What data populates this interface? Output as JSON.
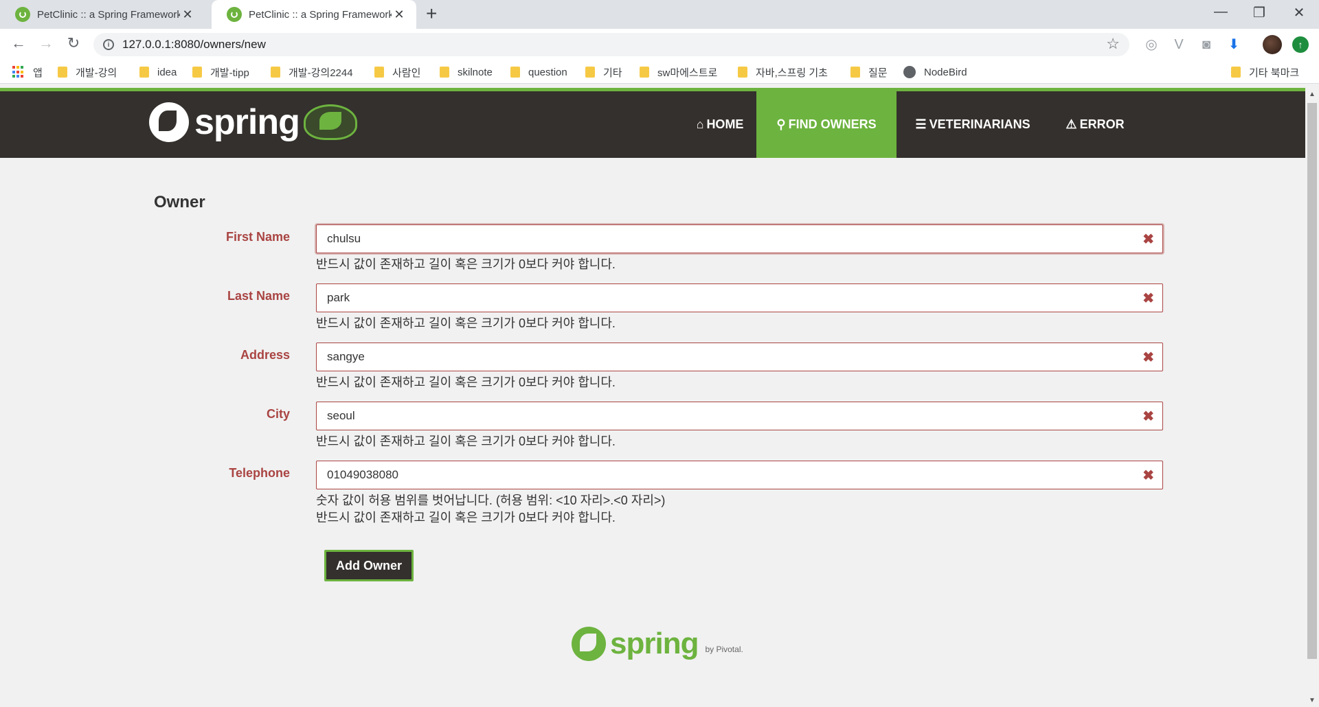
{
  "browser": {
    "tabs": [
      {
        "title": "PetClinic :: a Spring Framework"
      },
      {
        "title": "PetClinic :: a Spring Framework"
      }
    ],
    "new_tab": "+",
    "url": "127.0.0.1:8080/owners/new",
    "bookmarks": [
      {
        "label": "앱",
        "icon": "apps-icon"
      },
      {
        "label": "개발-강의",
        "icon": "folder-icon"
      },
      {
        "label": "idea",
        "icon": "folder-icon"
      },
      {
        "label": "개발-tipp",
        "icon": "folder-icon"
      },
      {
        "label": "개발-강의2244",
        "icon": "folder-icon"
      },
      {
        "label": "사람인",
        "icon": "folder-icon"
      },
      {
        "label": "skilnote",
        "icon": "folder-icon"
      },
      {
        "label": "question",
        "icon": "folder-icon"
      },
      {
        "label": "기타",
        "icon": "folder-icon"
      },
      {
        "label": "sw마에스트로",
        "icon": "folder-icon"
      },
      {
        "label": "자바,스프링 기초",
        "icon": "folder-icon"
      },
      {
        "label": "질문",
        "icon": "folder-icon"
      },
      {
        "label": "NodeBird",
        "icon": "globe-icon"
      }
    ],
    "other_bookmarks": "기타 북마크"
  },
  "navbar": {
    "brand": "spring",
    "items": [
      {
        "label": "Home",
        "icon": "home-icon"
      },
      {
        "label": "Find owners",
        "icon": "search-icon"
      },
      {
        "label": "Veterinarians",
        "icon": "list-icon"
      },
      {
        "label": "Error",
        "icon": "warning-icon"
      }
    ],
    "active": "Find owners"
  },
  "form": {
    "title": "Owner",
    "fields": [
      {
        "label": "First Name",
        "value": "chulsu",
        "errors": [
          "반드시 값이 존재하고 길이 혹은 크기가 0보다 커야 합니다."
        ]
      },
      {
        "label": "Last Name",
        "value": "park",
        "errors": [
          "반드시 값이 존재하고 길이 혹은 크기가 0보다 커야 합니다."
        ]
      },
      {
        "label": "Address",
        "value": "sangye",
        "errors": [
          "반드시 값이 존재하고 길이 혹은 크기가 0보다 커야 합니다."
        ]
      },
      {
        "label": "City",
        "value": "seoul",
        "errors": [
          "반드시 값이 존재하고 길이 혹은 크기가 0보다 커야 합니다."
        ]
      },
      {
        "label": "Telephone",
        "value": "01049038080",
        "errors": [
          "숫자 값이 허용 범위를 벗어납니다. (허용 범위: <10 자리>.<0 자리>)",
          "반드시 값이 존재하고 길이 혹은 크기가 0보다 커야 합니다."
        ]
      }
    ],
    "submit_label": "Add Owner"
  },
  "footer": {
    "logo_text": "spring",
    "by_text": "by Pivotal."
  },
  "colors": {
    "spring_green": "#6db33f",
    "navbar_bg": "#34302d",
    "error_red": "#a94442"
  }
}
